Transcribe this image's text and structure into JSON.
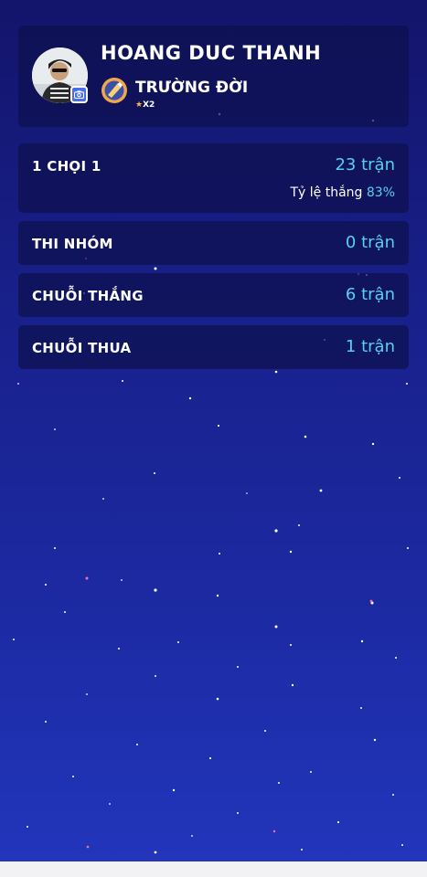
{
  "profile": {
    "name": "HOANG DUC THANH",
    "rank": "TRƯỜNG ĐỜI",
    "rank_stars": "X2",
    "icons": {
      "camera": "camera-icon",
      "rank": "rank-emblem-icon",
      "star": "star-icon"
    }
  },
  "stats": [
    {
      "label": "1 CHỌI 1",
      "value": "23 trận",
      "sub_label": "Tỷ lệ thắng",
      "sub_value": "83%"
    },
    {
      "label": "THI NHÓM",
      "value": "0 trận"
    },
    {
      "label": "CHUỖI THẮNG",
      "value": "6 trận"
    },
    {
      "label": "CHUỖI THUA",
      "value": "1 trận"
    }
  ],
  "colors": {
    "background_top": "#13146b",
    "background_bottom": "#2236bd",
    "accent": "#58d0ea",
    "card": "#0e104e"
  }
}
